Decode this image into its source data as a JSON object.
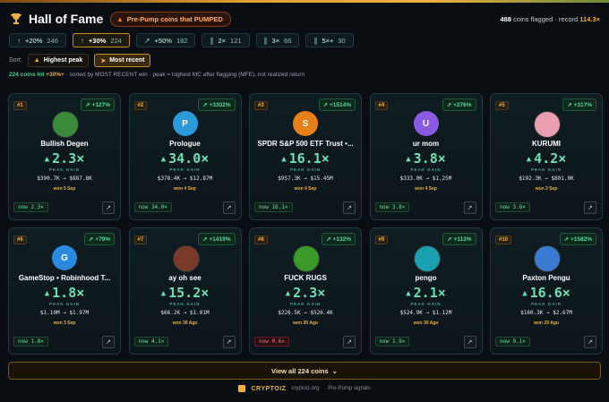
{
  "header": {
    "title": "Hall of Fame",
    "tag": "Pre-Pump coins that PUMPED",
    "flag_count": "488",
    "flag_text": "coins flagged · record",
    "record": "114.3×"
  },
  "filters": [
    {
      "label": "+20%",
      "count": "246",
      "icon": "arrow-up-icon"
    },
    {
      "label": "+30%",
      "count": "224",
      "icon": "arrow-up-icon",
      "active": true
    },
    {
      "label": "+50%",
      "count": "182",
      "icon": "trend-icon"
    },
    {
      "label": "2×",
      "count": "121",
      "icon": "bar-icon"
    },
    {
      "label": "3×",
      "count": "66",
      "icon": "bar-icon"
    },
    {
      "label": "5×+",
      "count": "30",
      "icon": "bar-icon"
    }
  ],
  "sort": {
    "label": "Sort:",
    "highest_peak": "Highest peak",
    "most_recent": "Most recent"
  },
  "subline": {
    "hit": "224 coins hit",
    "pct": "+30%+",
    "rest": "· sorted by MOST RECENT win · peak = highest MC after flagging (MFE), not realized return"
  },
  "cards": [
    {
      "rank": "#1",
      "peak": "+127%",
      "name": "Bullish Degen",
      "mult": "2.3×",
      "mc": "$390.7K → $887.8K",
      "won": "won 5 Sep",
      "now": "now 2.3×",
      "down": false,
      "avatar_letter": "",
      "avatar_color": "#3a8a3a"
    },
    {
      "rank": "#2",
      "peak": "+3302%",
      "name": "Prologue",
      "mult": "34.0×",
      "mc": "$378.4K → $12.87M",
      "won": "won 4 Sep",
      "now": "now 34.0×",
      "down": false,
      "avatar_letter": "P",
      "avatar_color": "#2a9ad8"
    },
    {
      "rank": "#3",
      "peak": "+1514%",
      "name": "SPDR S&P 500 ETF Trust •...",
      "mult": "16.1×",
      "mc": "$957.3K → $15.45M",
      "won": "won 4 Sep",
      "now": "now 16.1×",
      "down": false,
      "avatar_letter": "S",
      "avatar_color": "#e8801a"
    },
    {
      "rank": "#4",
      "peak": "+276%",
      "name": "ur mom",
      "mult": "3.8×",
      "mc": "$333.0K → $1.25M",
      "won": "won 4 Sep",
      "now": "now 3.8×",
      "down": false,
      "avatar_letter": "U",
      "avatar_color": "#8a5ae0"
    },
    {
      "rank": "#5",
      "peak": "+317%",
      "name": "KURUMI",
      "mult": "4.2×",
      "mc": "$192.3K → $801.0K",
      "won": "won 3 Sep",
      "now": "now 3.6×",
      "down": false,
      "avatar_letter": "",
      "avatar_color": "#e8a0b0"
    },
    {
      "rank": "#6",
      "peak": "+79%",
      "name": "GameStop • Robinhood T...",
      "mult": "1.8×",
      "mc": "$1.10M → $1.97M",
      "won": "won 3 Sep",
      "now": "now 1.8×",
      "down": false,
      "avatar_letter": "G",
      "avatar_color": "#2a8ae0"
    },
    {
      "rank": "#7",
      "peak": "+1419%",
      "name": "ay oh see",
      "mult": "15.2×",
      "mc": "$66.2K → $1.01M",
      "won": "won 30 Agu",
      "now": "now 4.1×",
      "down": false,
      "avatar_letter": "",
      "avatar_color": "#7a3a2a"
    },
    {
      "rank": "#8",
      "peak": "+132%",
      "name": "FUCK RUGS",
      "mult": "2.3×",
      "mc": "$226.5K → $526.4K",
      "won": "won 30 Agu",
      "now": "now 0.6×",
      "down": true,
      "avatar_letter": "",
      "avatar_color": "#3a9a2a"
    },
    {
      "rank": "#9",
      "peak": "+113%",
      "name": "pengo",
      "mult": "2.1×",
      "mc": "$524.9K → $1.12M",
      "won": "won 30 Agu",
      "now": "now 1.9×",
      "down": false,
      "avatar_letter": "",
      "avatar_color": "#1aa0b0"
    },
    {
      "rank": "#10",
      "peak": "+1582%",
      "name": "Paxton Pengu",
      "mult": "16.6×",
      "mc": "$160.3K → $2.67M",
      "won": "won 29 Agu",
      "now": "now 9.1×",
      "down": false,
      "avatar_letter": "",
      "avatar_color": "#3a7ad0"
    }
  ],
  "peak_gain_label": "PEAK GAIN",
  "view_all": "View all 224 coins",
  "footer": {
    "brand": "CRYPTOIZ",
    "site": "cryptoiz.org",
    "tagline": "· Pre-Pump signals"
  },
  "colors": {
    "accent": "#f0b040",
    "gain": "#6ae0b0",
    "loss": "#ff7080"
  }
}
